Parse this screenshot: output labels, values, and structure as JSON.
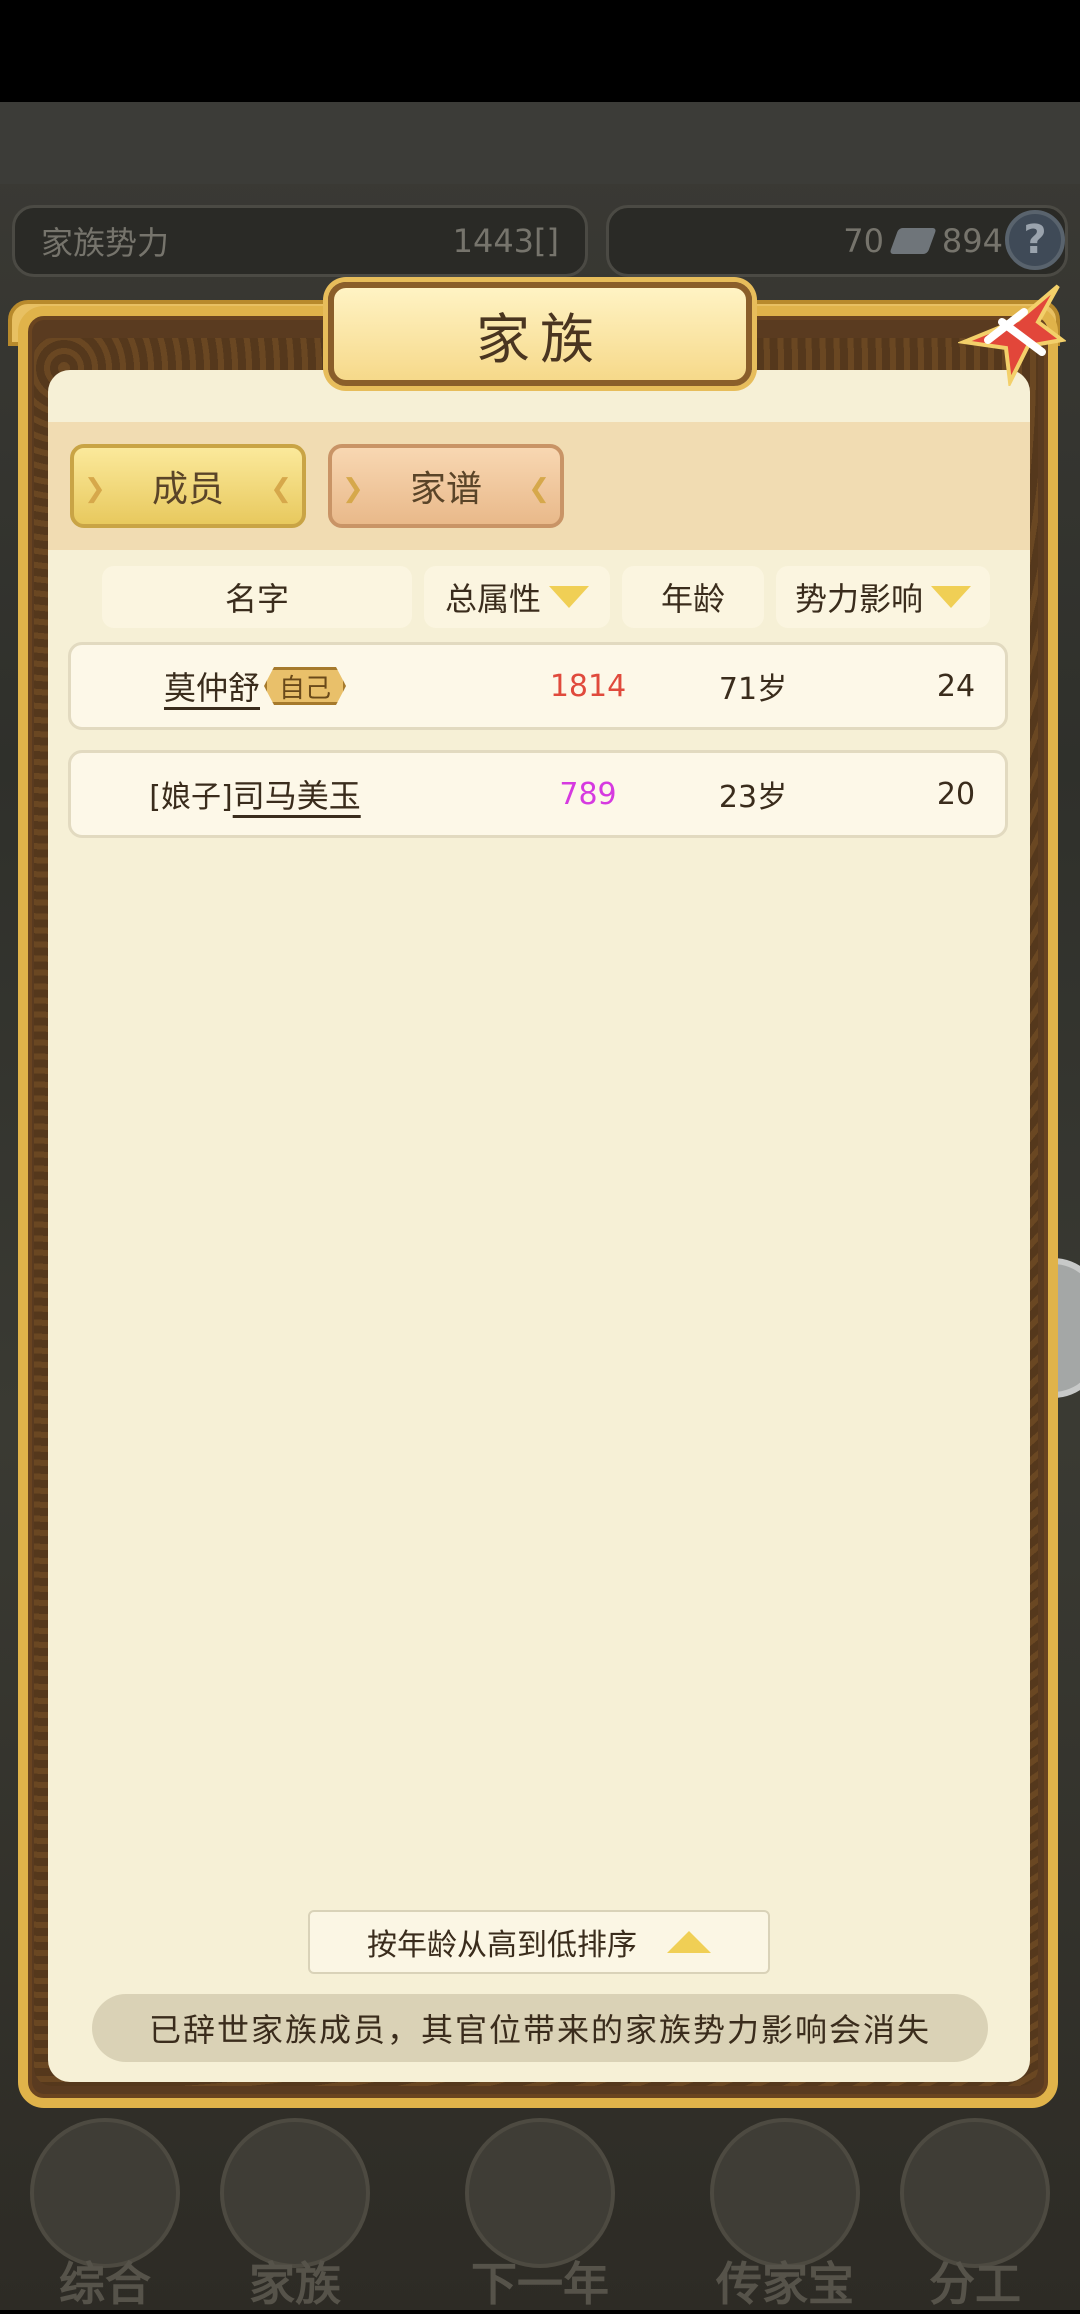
{
  "header": {
    "power_label": "家族势力",
    "power_value": "1443[",
    "power_rank": "",
    "power_close": "]",
    "gem_count": "70",
    "coin_count": "894",
    "help_label": "?"
  },
  "dialog": {
    "title": "家族",
    "tabs": [
      {
        "label": "成员"
      },
      {
        "label": "家谱"
      }
    ],
    "columns": {
      "name": "名字",
      "total_attr": "总属性",
      "age": "年龄",
      "influence": "势力影响"
    },
    "rows": [
      {
        "name": "莫仲舒",
        "badge": "自己",
        "total_attr": "1814",
        "attr_color": "#e04a3c",
        "age": "71岁",
        "influence": "24"
      },
      {
        "prefix": "[娘子]",
        "name": "司马美玉",
        "total_attr": "789",
        "attr_color": "#d63ae0",
        "age": "23岁",
        "influence": "20"
      }
    ],
    "sort_label": "按年龄从高到低排序",
    "notice": "已辞世家族成员，其官位带来的家族势力影响会消失"
  },
  "bottom_nav": [
    {
      "label": "综合",
      "icon": "scroll-icon"
    },
    {
      "label": "家族",
      "icon": "house-icon"
    },
    {
      "label": "下一年",
      "icon": "mountain-icon"
    },
    {
      "label": "传家宝",
      "icon": "treasure-icon"
    },
    {
      "label": "分工",
      "icon": "people-icon"
    }
  ]
}
